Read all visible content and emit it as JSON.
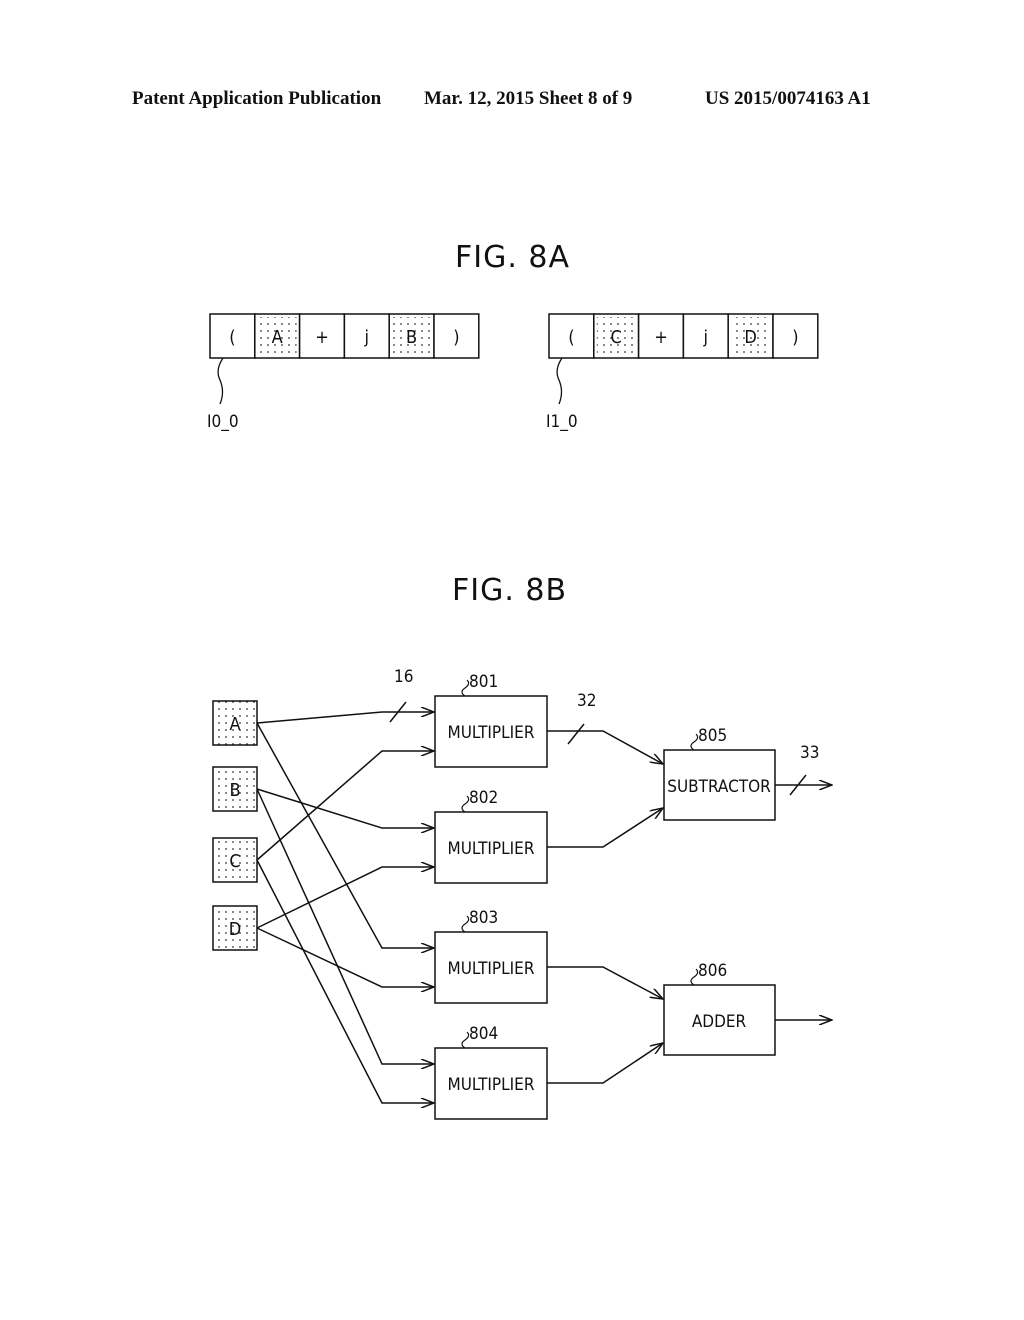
{
  "header": {
    "publication": "Patent Application Publication",
    "date_sheet": "Mar. 12, 2015  Sheet 8 of 9",
    "patent_number": "US 2015/0074163 A1"
  },
  "fig8a": {
    "title": "FIG. 8A",
    "registers": [
      {
        "label": "I0_0",
        "cells": [
          "(",
          "A",
          "+",
          "j",
          "B",
          ")"
        ],
        "shaded": [
          1,
          4
        ]
      },
      {
        "label": "I1_0",
        "cells": [
          "(",
          "C",
          "+",
          "j",
          "D",
          ")"
        ],
        "shaded": [
          1,
          4
        ]
      }
    ]
  },
  "fig8b": {
    "title": "FIG. 8B",
    "inputs": [
      "A",
      "B",
      "C",
      "D"
    ],
    "multipliers": [
      {
        "ref": "801",
        "label": "MULTIPLIER"
      },
      {
        "ref": "802",
        "label": "MULTIPLIER"
      },
      {
        "ref": "803",
        "label": "MULTIPLIER"
      },
      {
        "ref": "804",
        "label": "MULTIPLIER"
      }
    ],
    "subtractor": {
      "ref": "805",
      "label": "SUBTRACTOR"
    },
    "adder": {
      "ref": "806",
      "label": "ADDER"
    },
    "bus_widths": {
      "input": "16",
      "product": "32",
      "output": "33"
    }
  }
}
